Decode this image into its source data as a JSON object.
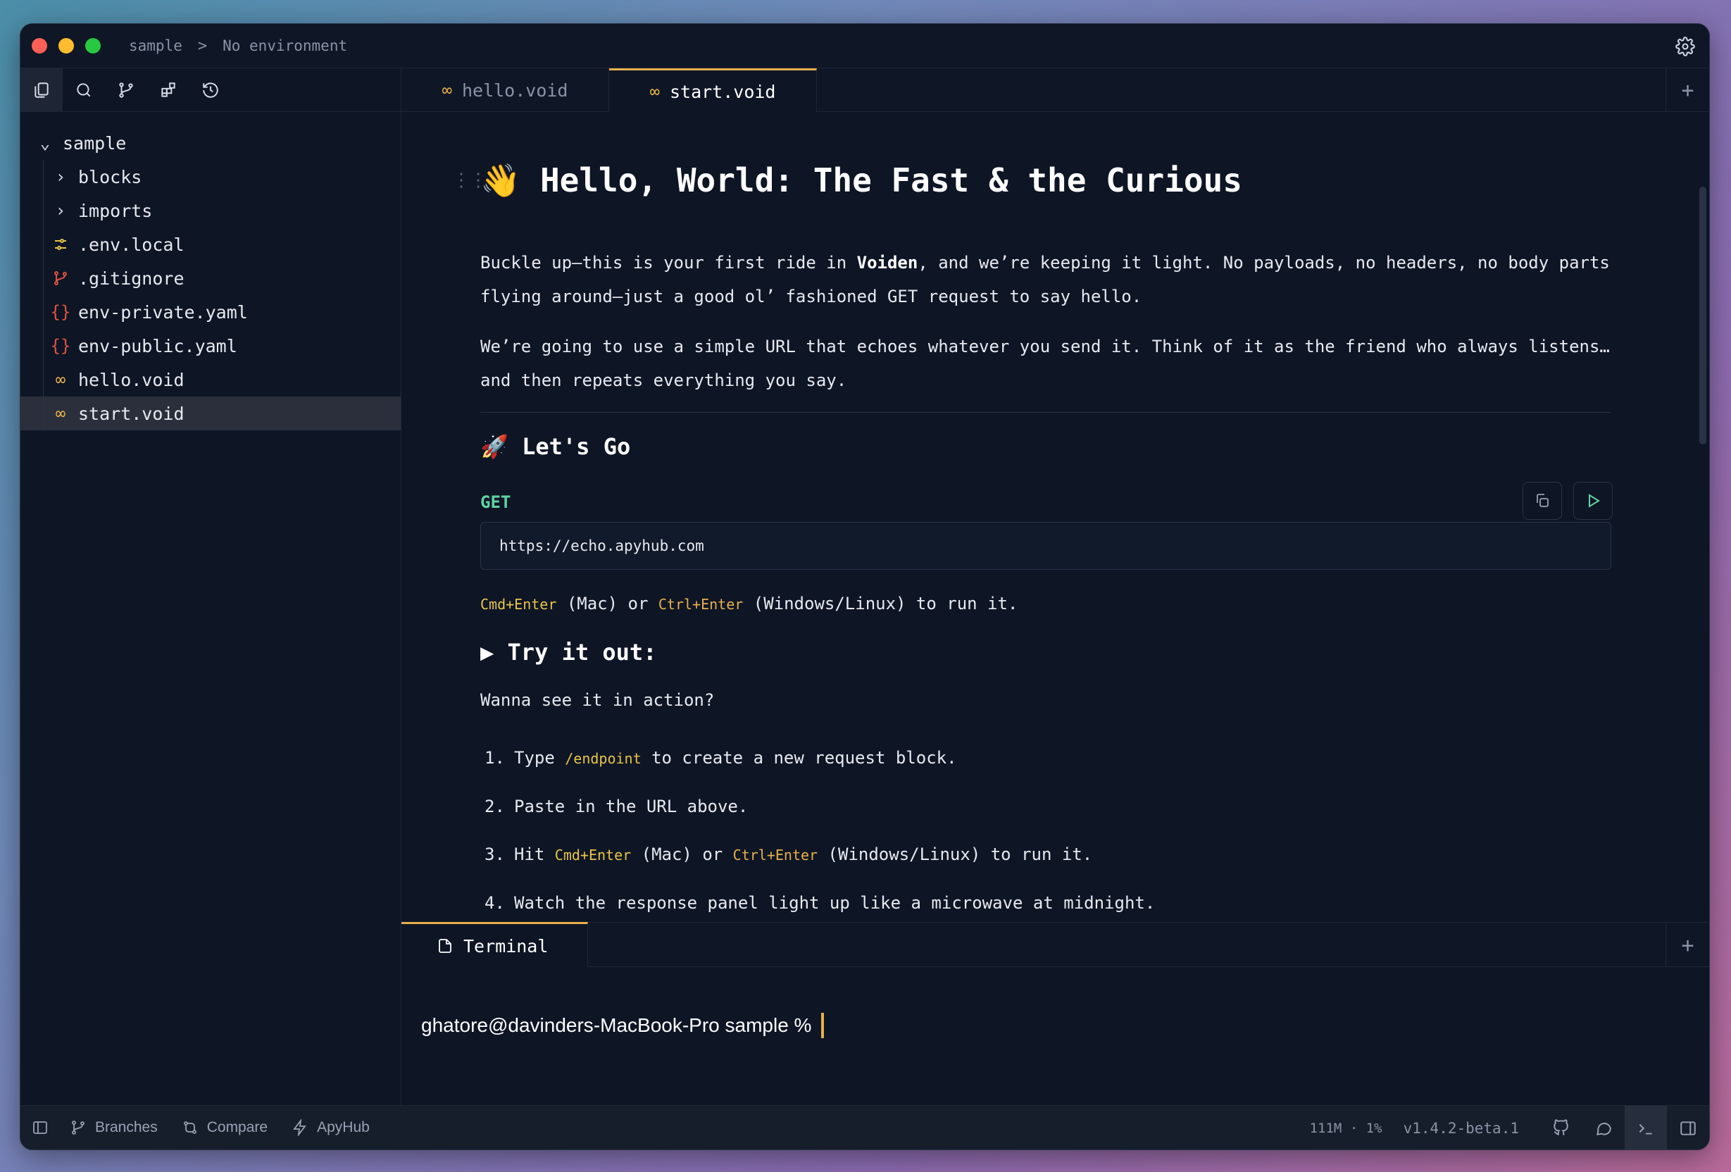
{
  "titlebar": {
    "project": "sample",
    "separator": ">",
    "environment": "No environment"
  },
  "sidebar": {
    "toolbar": [
      "files-icon",
      "search-icon",
      "git-branch-icon",
      "extensions-icon",
      "history-icon"
    ],
    "tree": [
      {
        "label": "sample",
        "icon": "chevron-down-icon",
        "depth": 0
      },
      {
        "label": "blocks",
        "icon": "chevron-right-icon",
        "depth": 1
      },
      {
        "label": "imports",
        "icon": "chevron-right-icon",
        "depth": 1
      },
      {
        "label": ".env.local",
        "icon": "env-icon",
        "depth": 1
      },
      {
        "label": ".gitignore",
        "icon": "git-icon",
        "depth": 1
      },
      {
        "label": "env-private.yaml",
        "icon": "braces-icon",
        "depth": 1
      },
      {
        "label": "env-public.yaml",
        "icon": "braces-icon",
        "depth": 1
      },
      {
        "label": "hello.void",
        "icon": "infinity-icon",
        "depth": 1
      },
      {
        "label": "start.void",
        "icon": "infinity-icon",
        "depth": 1,
        "selected": true
      }
    ]
  },
  "tabs": [
    {
      "label": "hello.void",
      "active": false
    },
    {
      "label": "start.void",
      "active": true
    }
  ],
  "doc": {
    "h1": "👋 Hello, World: The Fast & the Curious",
    "p1_a": "Buckle up—this is your first ride in ",
    "p1_bold": "Voiden",
    "p1_b": ", and we’re keeping it light. No payloads, no headers, no body parts flying around—just a good ol’ fashioned GET request to say hello.",
    "p2": "We’re going to use a simple URL that echoes whatever you send it. Think of it as the friend who always listens… and then repeats everything you say.",
    "h2": "🚀 Let's Go",
    "method": "GET",
    "url": "https://echo.apyhub.com",
    "run_hint": {
      "kbd_mac": "Cmd+Enter",
      "mid": " (Mac) or ",
      "kbd_win": "Ctrl+Enter",
      "end": " (Windows/Linux) to run it."
    },
    "h3": "▶ Try it out:",
    "intro": "Wanna see it in action?",
    "steps": [
      {
        "num": "1.",
        "pre": "Type ",
        "code": "/endpoint",
        "post": " to create a new request block."
      },
      {
        "num": "2.",
        "pre": "Paste in the URL above.",
        "code": "",
        "post": ""
      },
      {
        "num": "3.",
        "pre": "Hit ",
        "code": "Cmd+Enter",
        "mid": " (Mac) or ",
        "code2": "Ctrl+Enter",
        "post": " (Windows/Linux) to run it."
      },
      {
        "num": "4.",
        "pre": "Watch the response panel light up like a microwave at midnight.",
        "code": "",
        "post": ""
      }
    ]
  },
  "terminal": {
    "tab_label": "Terminal",
    "prompt": "ghatore@davinders-MacBook-Pro sample %"
  },
  "statusbar": {
    "branches": "Branches",
    "compare": "Compare",
    "apyhub": "ApyHub",
    "memory": "111M",
    "dot": "·",
    "cpu": "1%",
    "version": "v1.4.2-beta.1"
  },
  "colors": {
    "accent": "#e8b04a",
    "method_get": "#5fd3a4",
    "background": "#0e1525"
  }
}
